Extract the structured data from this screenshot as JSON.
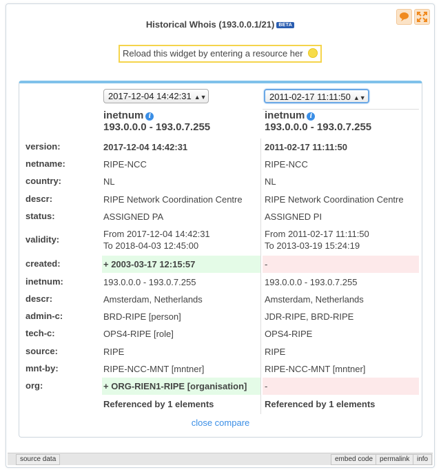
{
  "widget": {
    "title": "Historical Whois (193.0.0.1/21)",
    "badge": "BETA",
    "reload_text": "Reload this widget by entering a resource her",
    "icons": {
      "feedback": "speech-bubble-icon",
      "expand": "expand-icon",
      "reload_lamp": "bulb-icon"
    }
  },
  "compare": {
    "left": {
      "version_select": "2017-12-04 14:42:31",
      "object_type": "inetnum",
      "object_range": "193.0.0.0 - 193.0.7.255",
      "footer": "Referenced by 1 elements"
    },
    "right": {
      "version_select": "2011-02-17 11:11:50",
      "object_type": "inetnum",
      "object_range": "193.0.0.0 - 193.0.7.255",
      "footer": "Referenced by 1 elements"
    },
    "rows": [
      {
        "label": "version:",
        "left": "2017-12-04 14:42:31",
        "right": "2011-02-17 11:11:50"
      },
      {
        "label": "netname:",
        "left": "RIPE-NCC",
        "right": "RIPE-NCC"
      },
      {
        "label": "country:",
        "left": "NL",
        "right": "NL"
      },
      {
        "label": "descr:",
        "left": "RIPE Network Coordination Centre",
        "right": "RIPE Network Coordination Centre"
      },
      {
        "label": "status:",
        "left": "ASSIGNED PA",
        "right": "ASSIGNED PI"
      },
      {
        "label": "validity:",
        "left": "From 2017-12-04 14:42:31",
        "left2": "To 2018-04-03 12:45:00",
        "right": "From 2011-02-17 11:11:50",
        "right2": "To 2013-03-19 15:24:19"
      },
      {
        "label": "created:",
        "left": "+ 2003-03-17 12:15:57",
        "right": "-"
      },
      {
        "label": "inetnum:",
        "left": "193.0.0.0 - 193.0.7.255",
        "right": "193.0.0.0 - 193.0.7.255"
      },
      {
        "label": "descr:",
        "left": "Amsterdam, Netherlands",
        "right": "Amsterdam, Netherlands"
      },
      {
        "label": "admin-c:",
        "left": "BRD-RIPE [person]",
        "right": "JDR-RIPE, BRD-RIPE"
      },
      {
        "label": "tech-c:",
        "left": "OPS4-RIPE [role]",
        "right": "OPS4-RIPE"
      },
      {
        "label": "source:",
        "left": "RIPE",
        "right": "RIPE"
      },
      {
        "label": "mnt-by:",
        "left": "RIPE-NCC-MNT [mntner]",
        "right": "RIPE-NCC-MNT [mntner]"
      },
      {
        "label": "org:",
        "left": "+ ORG-RIEN1-RIPE [organisation]",
        "right": "-"
      }
    ],
    "close_link": "close compare"
  },
  "footer": {
    "source_data": "source data",
    "embed_code": "embed code",
    "permalink": "permalink",
    "info": "info"
  }
}
